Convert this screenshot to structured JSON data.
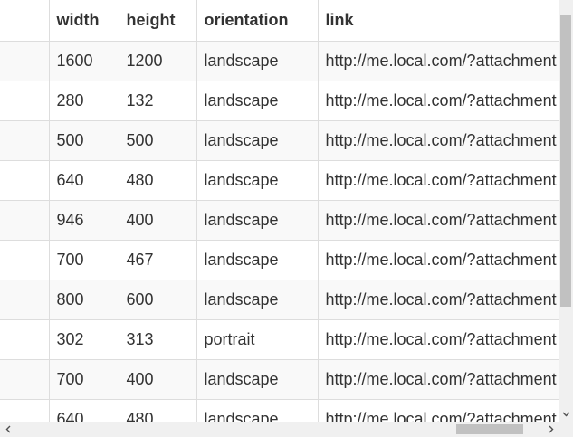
{
  "table": {
    "columns": [
      "",
      "width",
      "height",
      "orientation",
      "link"
    ],
    "rows": [
      {
        "c0": "",
        "width": "1600",
        "height": "1200",
        "orientation": "landscape",
        "link": "http://me.local.com/?attachment"
      },
      {
        "c0": "",
        "width": "280",
        "height": "132",
        "orientation": "landscape",
        "link": "http://me.local.com/?attachment"
      },
      {
        "c0": "",
        "width": "500",
        "height": "500",
        "orientation": "landscape",
        "link": "http://me.local.com/?attachment"
      },
      {
        "c0": "",
        "width": "640",
        "height": "480",
        "orientation": "landscape",
        "link": "http://me.local.com/?attachment"
      },
      {
        "c0": "",
        "width": "946",
        "height": "400",
        "orientation": "landscape",
        "link": "http://me.local.com/?attachment"
      },
      {
        "c0": "",
        "width": "700",
        "height": "467",
        "orientation": "landscape",
        "link": "http://me.local.com/?attachment"
      },
      {
        "c0": "",
        "width": "800",
        "height": "600",
        "orientation": "landscape",
        "link": "http://me.local.com/?attachment"
      },
      {
        "c0": "",
        "width": "302",
        "height": "313",
        "orientation": "portrait",
        "link": "http://me.local.com/?attachment"
      },
      {
        "c0": "",
        "width": "700",
        "height": "400",
        "orientation": "landscape",
        "link": "http://me.local.com/?attachment"
      },
      {
        "c0": "",
        "width": "640",
        "height": "480",
        "orientation": "landscape",
        "link": "http://me.local.com/?attachment"
      }
    ]
  },
  "scrollbars": {
    "horizontal": {
      "left_icon": "chevron-left-icon",
      "right_icon": "chevron-right-icon"
    },
    "vertical": {
      "down_icon": "chevron-down-icon"
    }
  },
  "colors": {
    "border": "#dddddd",
    "stripe": "#f9f9f9",
    "text": "#333333",
    "scrollbar_track": "#f0f0f0",
    "scrollbar_thumb": "#c1c1c1"
  }
}
